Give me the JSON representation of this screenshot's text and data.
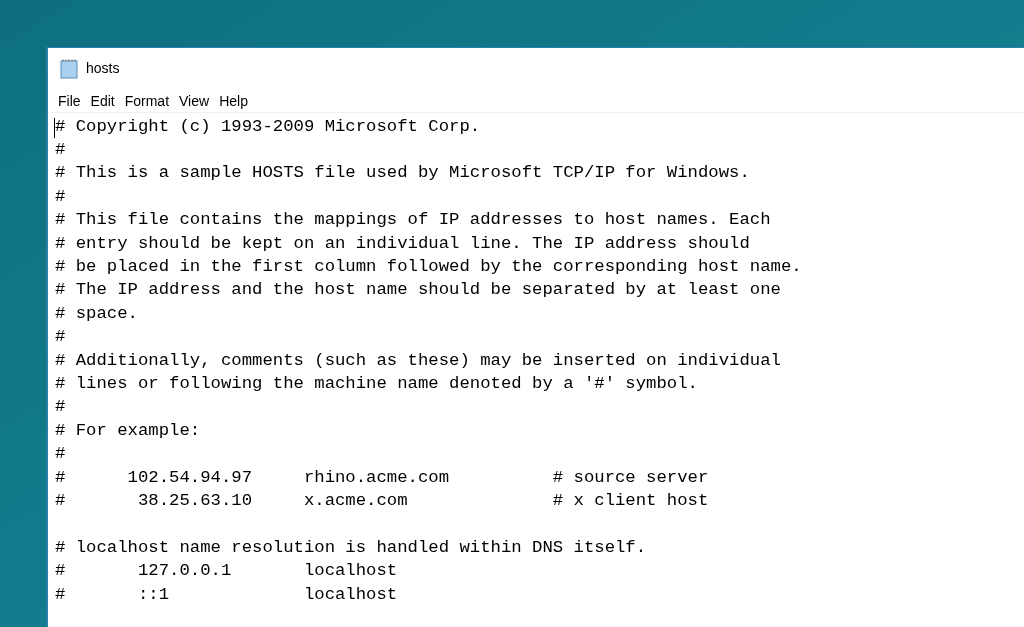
{
  "window": {
    "title": "hosts"
  },
  "menu": [
    "File",
    "Edit",
    "Format",
    "View",
    "Help"
  ],
  "editor": {
    "blocks": [
      [
        "# Copyright (c) 1993-2009 Microsoft Corp.",
        "#",
        "# This is a sample HOSTS file used by Microsoft TCP/IP for Windows.",
        "#",
        "# This file contains the mappings of IP addresses to host names. Each",
        "# entry should be kept on an individual line. The IP address should",
        "# be placed in the first column followed by the corresponding host name.",
        "# The IP address and the host name should be separated by at least one",
        "# space.",
        "#",
        "# Additionally, comments (such as these) may be inserted on individual",
        "# lines or following the machine name denoted by a '#' symbol.",
        "#",
        "# For example:",
        "#",
        "#      102.54.94.97     rhino.acme.com          # source server",
        "#       38.25.63.10     x.acme.com              # x client host"
      ],
      [
        "# localhost name resolution is handled within DNS itself.",
        "#       127.0.0.1       localhost",
        "#       ::1             localhost"
      ]
    ]
  }
}
